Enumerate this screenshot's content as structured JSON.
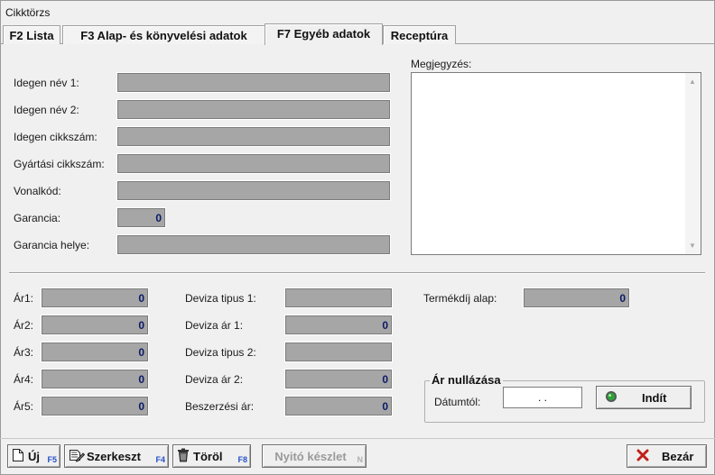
{
  "window": {
    "title": "Cikktörzs"
  },
  "tabs": [
    {
      "label": "F2 Lista"
    },
    {
      "label": "F3 Alap- és könyvelési adatok"
    },
    {
      "label": "F7 Egyéb adatok"
    },
    {
      "label": "Receptúra"
    }
  ],
  "fields": {
    "idegen_nev_1": {
      "label": "Idegen név 1:",
      "value": ""
    },
    "idegen_nev_2": {
      "label": "Idegen név 2:",
      "value": ""
    },
    "idegen_cikkszam": {
      "label": "Idegen cikkszám:",
      "value": ""
    },
    "gyartasi_cikkszam": {
      "label": "Gyártási cikkszám:",
      "value": ""
    },
    "vonalkod": {
      "label": "Vonalkód:",
      "value": ""
    },
    "garancia": {
      "label": "Garancia:",
      "value": "0"
    },
    "garancia_helye": {
      "label": "Garancia helye:",
      "value": ""
    }
  },
  "megjegyzes": {
    "label": "Megjegyzés:",
    "value": ""
  },
  "prices": {
    "ar1": {
      "label": "Ár1:",
      "value": "0"
    },
    "ar2": {
      "label": "Ár2:",
      "value": "0"
    },
    "ar3": {
      "label": "Ár3:",
      "value": "0"
    },
    "ar4": {
      "label": "Ár4:",
      "value": "0"
    },
    "ar5": {
      "label": "Ár5:",
      "value": "0"
    }
  },
  "currency": {
    "deviza_tipus_1": {
      "label": "Deviza tipus 1:",
      "value": ""
    },
    "deviza_ar_1": {
      "label": "Deviza ár 1:",
      "value": "0"
    },
    "deviza_tipus_2": {
      "label": "Deviza tipus 2:",
      "value": ""
    },
    "deviza_ar_2": {
      "label": "Deviza ár 2:",
      "value": "0"
    },
    "beszerzesi_ar": {
      "label": "Beszerzési ár:",
      "value": "0"
    }
  },
  "termekdij": {
    "label": "Termékdíj alap:",
    "value": "0"
  },
  "ar_nullazasa": {
    "title": "Ár nullázása",
    "datum_label": "Dátumtól:",
    "date_value": ".   .",
    "start_button": "Indít"
  },
  "toolbar": {
    "new": {
      "label": "Új",
      "key": "F5"
    },
    "edit": {
      "label": "Szerkeszt",
      "key": "F4"
    },
    "delete": {
      "label": "Töröl",
      "key": "F8"
    },
    "opening_stock": {
      "label": "Nyitó készlet",
      "key": "N"
    },
    "close": {
      "label": "Bezár"
    }
  },
  "icons": {
    "new": "new-document-icon",
    "edit": "edit-document-icon",
    "delete": "trash-icon",
    "close": "red-x-icon",
    "start": "green-led-icon"
  },
  "colors": {
    "field_bg": "#a6a6a6",
    "number_text": "#0a1a66",
    "shortcut_key": "#2550c8",
    "close_x": "#c0201a",
    "led": "#2fa13a"
  }
}
